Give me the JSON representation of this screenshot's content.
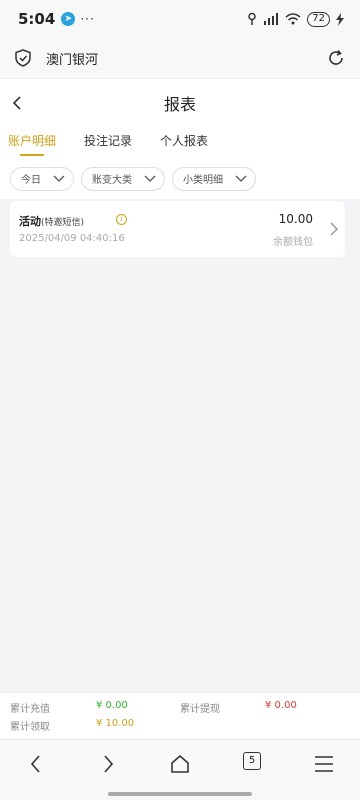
{
  "status": {
    "time": "5:04",
    "dots": "···",
    "battery": "72"
  },
  "browser": {
    "site_title": "澳门银河"
  },
  "header": {
    "title": "报表"
  },
  "tabs": [
    {
      "label": "账户明细",
      "active": true
    },
    {
      "label": "投注记录",
      "active": false
    },
    {
      "label": "个人报表",
      "active": false
    }
  ],
  "filters": [
    {
      "label": "今日"
    },
    {
      "label": "账变大类"
    },
    {
      "label": "小类明细"
    }
  ],
  "record": {
    "title": "活动",
    "subtitle": "(特邀短信)",
    "time": "2025/04/09 04:40:16",
    "amount": "10.00",
    "wallet": "余额钱包"
  },
  "summary": {
    "recharge_label": "累计充值",
    "recharge_value": "¥ 0.00",
    "withdraw_label": "累计提现",
    "withdraw_value": "¥ 0.00",
    "receive_label": "累计领取",
    "receive_value": "¥ 10.00"
  },
  "nav": {
    "tab_count": "5"
  },
  "colors": {
    "accent": "#d4a017",
    "green": "#2fb52f",
    "red": "#e53935"
  }
}
